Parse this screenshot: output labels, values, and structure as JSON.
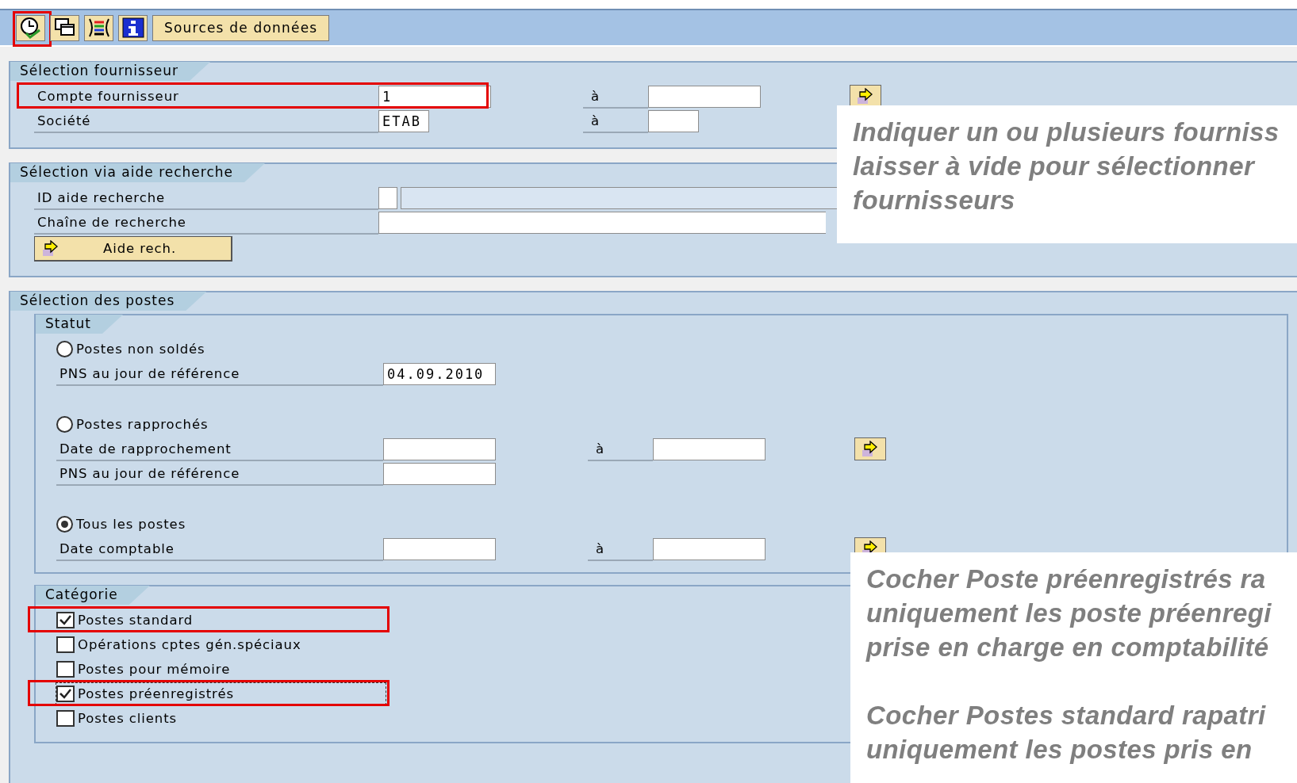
{
  "toolbar": {
    "icon_buttons": [
      {
        "kind": "execute",
        "highlighted": true
      },
      {
        "kind": "copy",
        "highlighted": false
      },
      {
        "kind": "columns",
        "highlighted": false
      },
      {
        "kind": "info",
        "highlighted": false
      }
    ],
    "text_button": "Sources de données"
  },
  "vendor_selection": {
    "title": "Sélection fournisseur",
    "rows": [
      {
        "label": "Compte fournisseur",
        "value": "1",
        "kind": "wide",
        "to_label": "à",
        "multi_button": true,
        "highlighted": true
      },
      {
        "label": "Société",
        "value": "ETAB",
        "kind": "narrow",
        "to_label": "à",
        "multi_button": false,
        "highlighted": false
      }
    ]
  },
  "search_help": {
    "title": "Sélection via aide recherche",
    "rows": [
      {
        "label": "ID aide recherche",
        "kind": "id"
      },
      {
        "label": "Chaîne de recherche",
        "kind": "long"
      }
    ],
    "button": "Aide rech."
  },
  "items_selection": {
    "title": "Sélection des postes",
    "status": {
      "title": "Statut",
      "options": [
        {
          "label": "Postes non soldés",
          "selected": false,
          "rows": [
            {
              "label": "PNS au jour de référence",
              "value": "04.09.2010"
            }
          ]
        },
        {
          "label": "Postes rapprochés",
          "selected": false,
          "rows": [
            {
              "label": "Date de rapprochement",
              "to_label": "à",
              "multi_button": true
            },
            {
              "label": "PNS au jour de référence"
            }
          ]
        },
        {
          "label": "Tous les postes",
          "selected": true,
          "rows": [
            {
              "label": "Date comptable",
              "to_label": "à",
              "multi_button": true
            }
          ]
        }
      ]
    },
    "category": {
      "title": "Catégorie",
      "items": [
        {
          "label": "Postes standard",
          "checked": true,
          "highlighted": true,
          "focused": false
        },
        {
          "label": "Opérations cptes gén.spéciaux",
          "checked": false,
          "highlighted": false,
          "focused": false
        },
        {
          "label": "Postes pour mémoire",
          "checked": false,
          "highlighted": false,
          "focused": false
        },
        {
          "label": "Postes préenregistrés",
          "checked": true,
          "highlighted": true,
          "focused": true
        },
        {
          "label": "Postes clients",
          "checked": false,
          "highlighted": false,
          "focused": false
        }
      ]
    }
  },
  "callouts": [
    {
      "paragraphs": [
        [
          "Indiquer un ou plusieurs fourniss",
          "laisser à vide pour sélectionner",
          "fournisseurs"
        ]
      ]
    },
    {
      "paragraphs": [
        [
          "Cocher Poste préenregistrés ra",
          "uniquement les poste préenregi",
          "prise en charge en comptabilité"
        ],
        [
          "Cocher Postes standard rapatri",
          "uniquement les postes pris en"
        ]
      ]
    }
  ]
}
